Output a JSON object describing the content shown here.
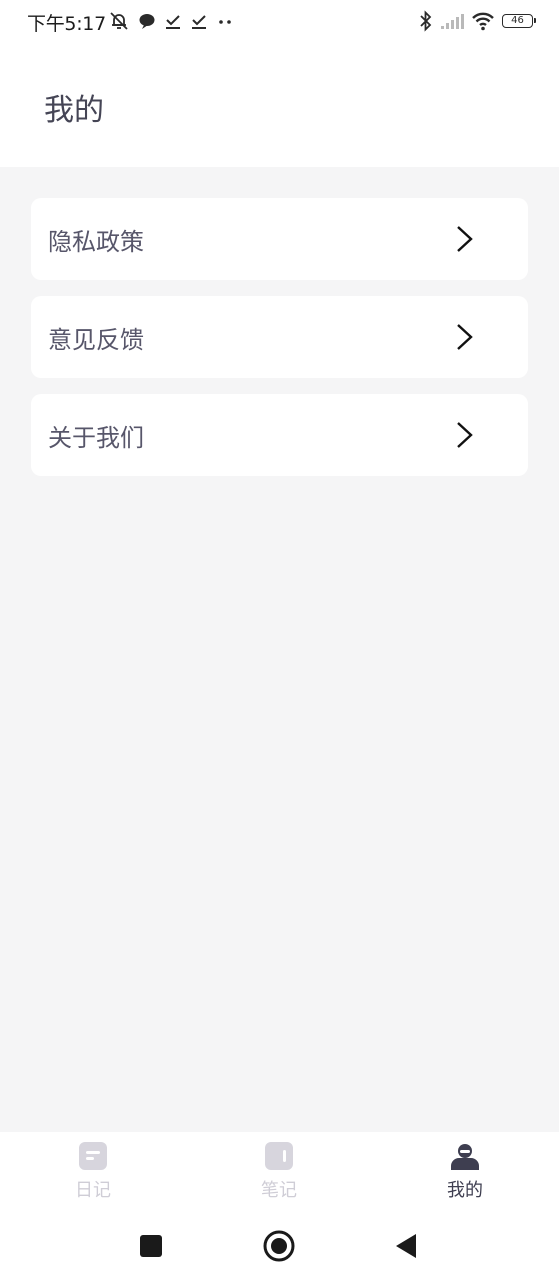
{
  "status_bar": {
    "time": "下午5:17",
    "battery_level": "46",
    "icons": [
      "mute-bell-icon",
      "chat-bubble-icon",
      "checkmark-icon",
      "checkmark-icon",
      "more-dots-icon",
      "bluetooth-icon",
      "signal-icon",
      "wifi-icon",
      "battery-icon"
    ]
  },
  "header": {
    "title": "我的"
  },
  "menu": {
    "items": [
      {
        "label": "隐私政策",
        "icon": "chevron-right-icon"
      },
      {
        "label": "意见反馈",
        "icon": "chevron-right-icon"
      },
      {
        "label": "关于我们",
        "icon": "chevron-right-icon"
      }
    ]
  },
  "tab_bar": {
    "tabs": [
      {
        "label": "日记",
        "icon": "diary-icon",
        "active": false
      },
      {
        "label": "笔记",
        "icon": "notes-icon",
        "active": false
      },
      {
        "label": "我的",
        "icon": "profile-icon",
        "active": true
      }
    ],
    "active_color": "#3e3e50",
    "inactive_color": "#cfcdd6"
  },
  "system_nav": {
    "buttons": [
      "recents-button",
      "home-button",
      "back-button"
    ]
  }
}
